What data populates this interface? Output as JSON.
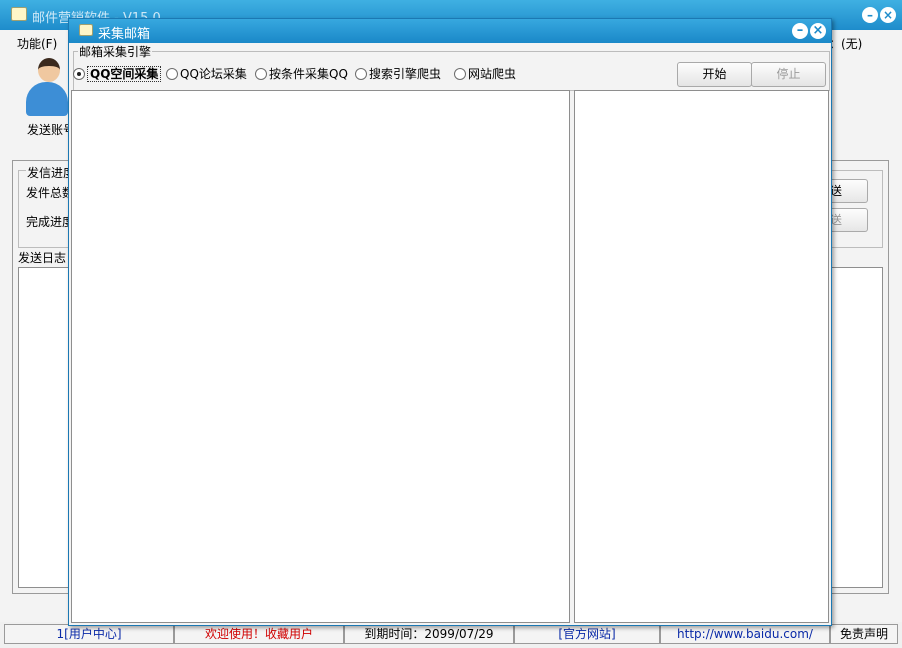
{
  "main_window": {
    "title": "邮件营销软件 - V15.0",
    "menu": {
      "function_label": "功能(F)",
      "status_text": "：(无)"
    },
    "toolbar": {
      "send_account_label": "发送账号"
    },
    "progress_group": {
      "legend": "发信进度",
      "total_label": "发件总数",
      "done_label": "完成进度",
      "send_button": "送",
      "stop_send_button": "送"
    },
    "log": {
      "label": "发送日志"
    },
    "statusbar": {
      "cells": [
        "1[用户中心]",
        "欢迎使用！收藏用户",
        "到期时间：2099/07/29",
        "[官方网站]",
        "http://www.baidu.com/",
        "免责声明"
      ]
    }
  },
  "dialog": {
    "title": "采集邮箱",
    "engine_group_label": "邮箱采集引擎",
    "options": [
      {
        "label": "QQ空间采集",
        "selected": true
      },
      {
        "label": "QQ论坛采集",
        "selected": false
      },
      {
        "label": "按条件采集QQ",
        "selected": false
      },
      {
        "label": "搜索引擎爬虫",
        "selected": false
      },
      {
        "label": "网站爬虫",
        "selected": false
      }
    ],
    "start_button": "开始",
    "stop_button": "停止"
  },
  "colors": {
    "titlebar": "#1a88c8",
    "link": "#0a2aa8",
    "warning": "#d10000"
  },
  "icons": [
    "mail-app-icon",
    "minimize-icon",
    "close-icon",
    "user-avatar-icon"
  ]
}
